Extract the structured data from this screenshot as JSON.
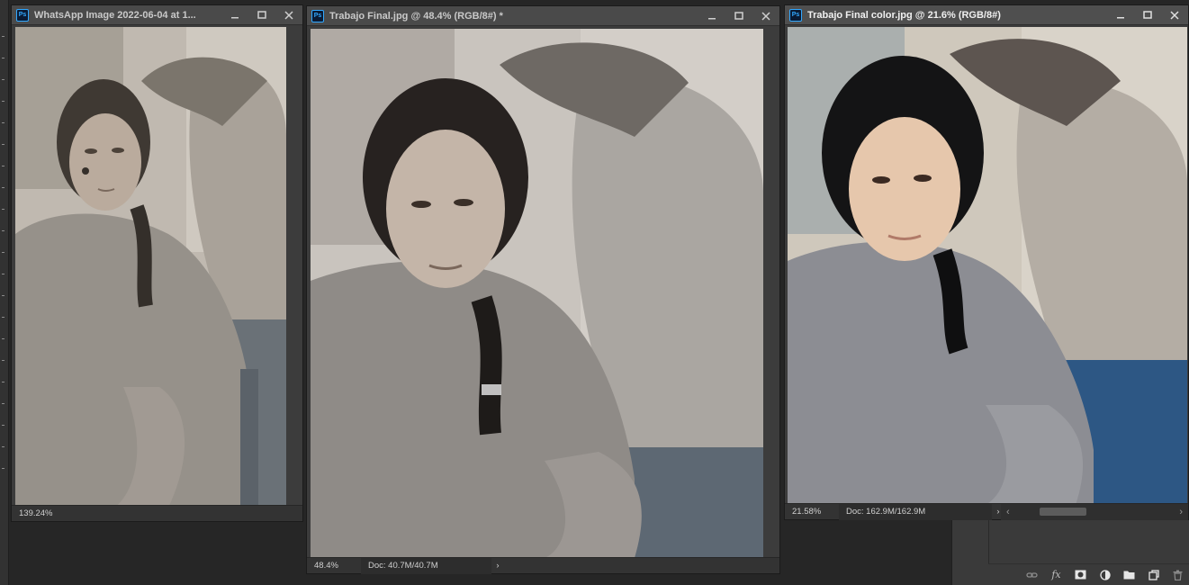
{
  "windows": [
    {
      "title": "WhatsApp Image 2022-06-04 at 1...",
      "zoom": "139.24%",
      "doc": "",
      "tone": "sepia"
    },
    {
      "title": "Trabajo Final.jpg @ 48.4% (RGB/8#) *",
      "zoom": "48.4%",
      "doc": "Doc: 40.7M/40.7M",
      "tone": "restored"
    },
    {
      "title": "Trabajo Final color.jpg @ 21.6% (RGB/8#)",
      "zoom": "21.58%",
      "doc": "Doc: 162.9M/162.9M",
      "tone": "color"
    }
  ],
  "icons": {
    "app_badge": "Ps",
    "minimize": "minimize-icon",
    "maximize": "maximize-icon",
    "close": "close-icon",
    "status_arrow": "›",
    "scroll_left": "‹",
    "scroll_right": "›",
    "panel_fx": "fx"
  },
  "colors": {
    "app_bg": "#262626",
    "title_bar": "#4a4a4a",
    "ps_blue": "#31a8ff"
  }
}
